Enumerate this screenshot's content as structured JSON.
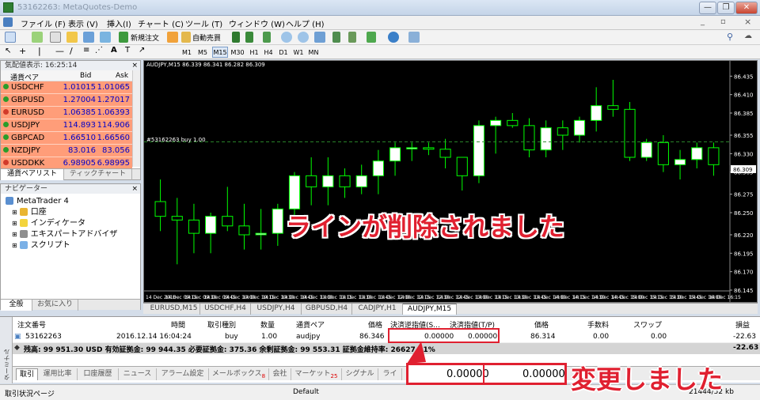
{
  "window": {
    "title": "53162263: MetaQuotes-Demo",
    "min": "—",
    "restore": "❐",
    "close": "✕"
  },
  "menu": [
    "ファイル (F)",
    "表示 (V)",
    "挿入(I)",
    "チャート (C)",
    "ツール (T)",
    "ウィンドウ (W)",
    "ヘルプ (H)"
  ],
  "toolbar": {
    "new_order": "新規注文",
    "autotrade": "自動売買"
  },
  "timeframes": [
    "M1",
    "M5",
    "M15",
    "M30",
    "H1",
    "H4",
    "D1",
    "W1",
    "MN"
  ],
  "active_timeframe": "M15",
  "market_watch": {
    "title": "気配値表示: 16:25:14",
    "col_symbol": "通貨ペア",
    "col_bid": "Bid",
    "col_ask": "Ask",
    "rows": [
      {
        "sym": "USDCHF",
        "bid": "1.01015",
        "ask": "1.01065"
      },
      {
        "sym": "GBPUSD",
        "bid": "1.27004",
        "ask": "1.27017"
      },
      {
        "sym": "EURUSD",
        "bid": "1.06385",
        "ask": "1.06393"
      },
      {
        "sym": "USDJPY",
        "bid": "114.893",
        "ask": "114.906"
      },
      {
        "sym": "GBPCAD",
        "bid": "1.66510",
        "ask": "1.66560"
      },
      {
        "sym": "NZDJPY",
        "bid": "83.016",
        "ask": "83.056"
      },
      {
        "sym": "USDDKK",
        "bid": "6.98905",
        "ask": "6.98995"
      }
    ],
    "tab1": "通貨ペアリスト",
    "tab2": "ティックチャート"
  },
  "navigator": {
    "title": "ナビゲーター",
    "root": "MetaTrader 4",
    "items": [
      "口座",
      "インディケータ",
      "エキスパートアドバイザ",
      "スクリプト"
    ],
    "tab1": "全般",
    "tab2": "お気に入り"
  },
  "chart": {
    "header": "AUDJPY,M15  86.339 86.341 86.282 86.309",
    "order_label": "#53162263 buy 1.00",
    "current_price": "86.309",
    "price_ticks": [
      "86.435",
      "86.410",
      "86.385",
      "86.355",
      "86.330",
      "86.305",
      "86.275",
      "86.250",
      "86.220",
      "86.195",
      "86.170",
      "86.145"
    ],
    "time_ticks": [
      "14 Dec 2016",
      "14 Dec 09:15",
      "14 Dec 09:30",
      "14 Dec 09:45",
      "14 Dec 10:00",
      "14 Dec 10:15",
      "14 Dec 10:30",
      "14 Dec 10:45",
      "14 Dec 11:00",
      "14 Dec 11:15",
      "14 Dec 11:30",
      "14 Dec 11:45",
      "14 Dec 12:00",
      "14 Dec 12:15",
      "14 Dec 12:30",
      "14 Dec 12:45",
      "14 Dec 13:00",
      "14 Dec 13:15",
      "14 Dec 13:30",
      "14 Dec 13:45",
      "14 Dec 14:00",
      "14 Dec 14:15",
      "14 Dec 14:30",
      "14 Dec 14:45",
      "14 Dec 15:00",
      "14 Dec 15:15",
      "14 Dec 15:30",
      "14 Dec 15:45",
      "14 Dec 16:00",
      "14 Dec 16:15"
    ],
    "tabs": [
      "EURUSD,M15",
      "USDCHF,H4",
      "USDJPY,H4",
      "GBPUSD,H4",
      "CADJPY,H1",
      "AUDJPY,M15"
    ],
    "active_tab": "AUDJPY,M15",
    "colors": {
      "bull": "#ffffff",
      "bear": "#000000",
      "wick": "#00ff00",
      "grid": "#2a2a2a",
      "axis_text": "#ffffff"
    }
  },
  "chart_data": {
    "type": "candlestick",
    "symbol": "AUDJPY",
    "timeframe": "M15",
    "ylim": [
      86.145,
      86.445
    ],
    "order_price": 86.346,
    "candles": [
      {
        "o": 86.265,
        "h": 86.295,
        "l": 86.225,
        "c": 86.245
      },
      {
        "o": 86.245,
        "h": 86.27,
        "l": 86.18,
        "c": 86.24
      },
      {
        "o": 86.24,
        "h": 86.262,
        "l": 86.195,
        "c": 86.222
      },
      {
        "o": 86.222,
        "h": 86.25,
        "l": 86.195,
        "c": 86.245
      },
      {
        "o": 86.245,
        "h": 86.285,
        "l": 86.225,
        "c": 86.232
      },
      {
        "o": 86.232,
        "h": 86.262,
        "l": 86.2,
        "c": 86.22
      },
      {
        "o": 86.22,
        "h": 86.255,
        "l": 86.2,
        "c": 86.222
      },
      {
        "o": 86.222,
        "h": 86.262,
        "l": 86.205,
        "c": 86.255
      },
      {
        "o": 86.255,
        "h": 86.305,
        "l": 86.235,
        "c": 86.3
      },
      {
        "o": 86.3,
        "h": 86.325,
        "l": 86.26,
        "c": 86.285
      },
      {
        "o": 86.285,
        "h": 86.325,
        "l": 86.26,
        "c": 86.3
      },
      {
        "o": 86.3,
        "h": 86.31,
        "l": 86.27,
        "c": 86.285
      },
      {
        "o": 86.285,
        "h": 86.315,
        "l": 86.275,
        "c": 86.3
      },
      {
        "o": 86.3,
        "h": 86.335,
        "l": 86.275,
        "c": 86.32
      },
      {
        "o": 86.32,
        "h": 86.345,
        "l": 86.3,
        "c": 86.338
      },
      {
        "o": 86.338,
        "h": 86.345,
        "l": 86.32,
        "c": 86.338
      },
      {
        "o": 86.338,
        "h": 86.345,
        "l": 86.328,
        "c": 86.336
      },
      {
        "o": 86.336,
        "h": 86.35,
        "l": 86.31,
        "c": 86.325
      },
      {
        "o": 86.325,
        "h": 86.325,
        "l": 86.28,
        "c": 86.3
      },
      {
        "o": 86.3,
        "h": 86.375,
        "l": 86.29,
        "c": 86.368
      },
      {
        "o": 86.368,
        "h": 86.38,
        "l": 86.33,
        "c": 86.375
      },
      {
        "o": 86.375,
        "h": 86.385,
        "l": 86.365,
        "c": 86.368
      },
      {
        "o": 86.368,
        "h": 86.378,
        "l": 86.325,
        "c": 86.335
      },
      {
        "o": 86.335,
        "h": 86.375,
        "l": 86.325,
        "c": 86.365
      },
      {
        "o": 86.365,
        "h": 86.375,
        "l": 86.335,
        "c": 86.355
      },
      {
        "o": 86.355,
        "h": 86.38,
        "l": 86.345,
        "c": 86.375
      },
      {
        "o": 86.375,
        "h": 86.42,
        "l": 86.36,
        "c": 86.395
      },
      {
        "o": 86.395,
        "h": 86.43,
        "l": 86.38,
        "c": 86.39
      },
      {
        "o": 86.39,
        "h": 86.4,
        "l": 86.32,
        "c": 86.325
      },
      {
        "o": 86.325,
        "h": 86.35,
        "l": 86.32,
        "c": 86.345
      },
      {
        "o": 86.345,
        "h": 86.355,
        "l": 86.305,
        "c": 86.315
      },
      {
        "o": 86.315,
        "h": 86.335,
        "l": 86.295,
        "c": 86.322
      },
      {
        "o": 86.322,
        "h": 86.345,
        "l": 86.31,
        "c": 86.338
      },
      {
        "o": 86.338,
        "h": 86.345,
        "l": 86.3,
        "c": 86.315
      }
    ]
  },
  "terminal": {
    "side_label": "ターミナル",
    "headers": {
      "order": "注文番号",
      "time": "時間",
      "type": "取引種別",
      "size": "数量",
      "symbol": "通貨ペア",
      "price": "価格",
      "sl": "決済逆指値(S...",
      "tp": "決済指値(T/P)",
      "price2": "価格",
      "commission": "手数料",
      "swap": "スワップ",
      "profit": "損益"
    },
    "order": {
      "order": "53162263",
      "time": "2016.12.14 16:04:24",
      "type": "buy",
      "size": "1.00",
      "symbol": "audjpy",
      "price": "86.346",
      "sl": "0.00000",
      "tp": "0.00000",
      "price2": "86.314",
      "commission": "0.00",
      "swap": "0.00",
      "profit": "-22.63"
    },
    "balance": "残高: 99 951.30 USD  有効証拠金: 99 944.35  必要証拠金: 375.36  余剰証拠金: 99 553.31  証拠金維持率: 26627.91%",
    "balance_profit": "-22.63",
    "tabs": [
      "取引",
      "運用比率",
      "口座履歴",
      "ニュース",
      "アラーム設定",
      "メールボックス",
      "会社",
      "マーケット",
      "シグナル",
      "ライ"
    ],
    "mail_badge": "8",
    "market_badge": "25"
  },
  "status": {
    "left": "取引状況ページ",
    "center": "Default",
    "right": "21444/52 kb"
  },
  "callouts": {
    "deleted": "ラインが削除されました",
    "changed": "変更しました",
    "zoom_sl": "0.00000",
    "zoom_tp": "0.00000"
  }
}
